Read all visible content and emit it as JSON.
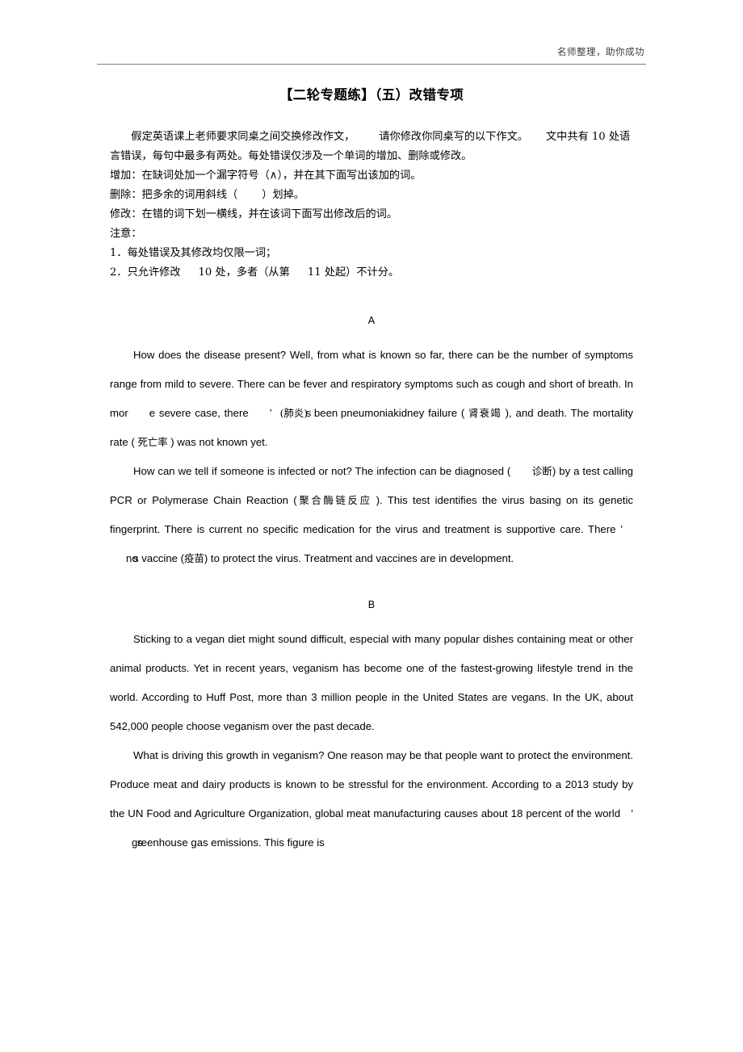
{
  "header": {
    "watermark": "名师整理，助你成功"
  },
  "title": "【二轮专题练】（五）改错专项",
  "instructions": {
    "lead_part1": "假定英语课上老师要求同桌之间交换修改作文，",
    "lead_part2": "请你修改你同桌写的以下作文。",
    "lead_part3": "文中共有 10 处语言错误，每句中最多有两处。每处错误仅涉及一个单词的增加、删除或修改。",
    "line_add": "增加：在缺词处加一个漏字符号（∧），并在其下面写出该加的词。",
    "line_delete_a": "删除：把多余的词用斜线（",
    "line_delete_b": "）划掉。",
    "line_modify": "修改：在错的词下划一横线，并在该词下面写出修改后的词。",
    "notice_label": "注意：",
    "notice_1": "1．每处错误及其修改均仅限一词；",
    "notice_2_a": "2．只允许修改",
    "notice_2_b": "10 处，多者（从第",
    "notice_2_c": "11 处起）不计分。"
  },
  "sections": [
    {
      "letter": "A",
      "paragraphs": [
        {
          "id": "a-p1",
          "text_1": "How does the disease present? Well, from what is known so far, there can be the number of symptoms range from mild to severe. There can be fever and respiratory symptoms such as cough and short of breath. In mor",
          "text_2": "e severe case, there",
          "apostrophe": "’",
          "text_3": "s been pneumonia",
          "gloss_1": "(肺炎)",
          "text_4": "kidney failure (",
          "gloss_2": "肾衰竭",
          "text_5": "), and death. The mortality rate (",
          "gloss_3": "死亡率",
          "text_6": ") was not known yet."
        },
        {
          "id": "a-p2",
          "text_1": "How can we tell if someone is infected or not? The infection can be diagnosed (",
          "gloss_1": "诊断",
          "text_2": ") by a test calling PCR or Polymerase Chain Reaction (",
          "gloss_2": "聚合酶链反应",
          "text_3": "). This test identifies the virus basing on its genetic fingerprint. There is current no specific medication for the virus and treatment is supportive care. There",
          "apostrophe": "’",
          "text_4": "s",
          "text_overlap": "no",
          "text_5": "vaccine (",
          "gloss_3": "疫苗",
          "text_6": ") to protect the virus. Treatment and vaccines are in development."
        }
      ]
    },
    {
      "letter": "B",
      "paragraphs": [
        {
          "id": "b-p1",
          "text_1": "Sticking to a vegan diet might sound difficult, especial with many popular dishes containing meat or other animal products. Yet in recent years, veganism has become one of the fastest-growing lifestyle trend in the world. According to Huff Post, more than 3 million people in the United States are vegans. In the UK, about 542,000 people choose veganism over the past decade."
        },
        {
          "id": "b-p2",
          "text_1": "What is driving this growth in veganism? One reason may be that people want to protect the environment. Produce meat and dairy products is known to be stressful for the environment. According to a 2013 study by the UN Food and Agriculture Organization, global meat manufacturing causes about 18 percent of the world",
          "apostrophe": "’",
          "text_2": "s",
          "text_3": "greenhouse gas emissions. This figure is"
        }
      ]
    }
  ]
}
